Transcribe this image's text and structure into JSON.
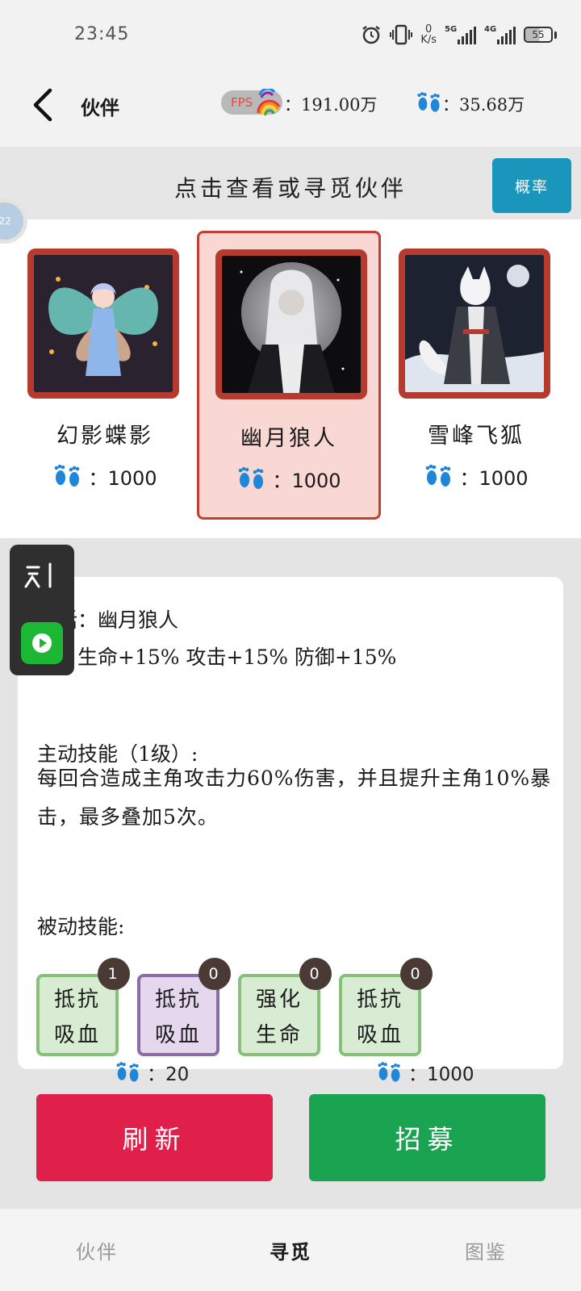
{
  "status_bar": {
    "time": "23:45",
    "net_speed_value": "0",
    "net_speed_unit": "K/s",
    "signal1_tag": "5G",
    "signal2_tag": "4G",
    "battery": "55",
    "icons": [
      "alarm-icon",
      "vibrate-icon",
      "signal-icon",
      "battery-icon"
    ]
  },
  "header": {
    "title": "伙伴",
    "fps_label": "FPS",
    "resource1_value": "：191.00万",
    "resource2_value": "：35.68万",
    "icons": [
      "back-arrow-icon",
      "rainbow-icon",
      "footprint-icon"
    ]
  },
  "banner": {
    "text": "点击查看或寻觅伙伴",
    "probability_button": "概率"
  },
  "float_ball": {
    "label": "22"
  },
  "cards": [
    {
      "name": "幻影蝶影",
      "cost": "：1000",
      "selected": false
    },
    {
      "name": "幽月狼人",
      "cost": "：1000",
      "selected": true
    },
    {
      "name": "雪峰飞狐",
      "cost": "：1000",
      "selected": false
    }
  ],
  "details": {
    "myth_line": "神话：幽月狼人",
    "attr_line": "性：生命+15% 攻击+15% 防御+15%",
    "active_title": "主动技能（1级）:",
    "active_desc": "每回合造成主角攻击力60%伤害，并且提升主角10%暴击，最多叠加5次。",
    "passive_title": "被动技能:",
    "passive_skills": [
      {
        "line1": "抵抗",
        "line2": "吸血",
        "level": "1",
        "color": "green"
      },
      {
        "line1": "抵抗",
        "line2": "吸血",
        "level": "0",
        "color": "purple"
      },
      {
        "line1": "强化",
        "line2": "生命",
        "level": "0",
        "color": "green"
      },
      {
        "line1": "抵抗",
        "line2": "吸血",
        "level": "0",
        "color": "green"
      }
    ]
  },
  "costs": {
    "refresh_cost": "：20",
    "recruit_cost": "：1000"
  },
  "actions": {
    "refresh": "刷新",
    "recruit": "招募"
  },
  "bottom_nav": {
    "items": [
      "伙伴",
      "寻觅",
      "图鉴"
    ],
    "active": "寻觅"
  },
  "colors": {
    "accent_blue": "#1a95bb",
    "refresh_red": "#e01f4b",
    "recruit_green": "#1aa452",
    "card_border": "#b73a2f",
    "selected_bg": "#f9d7d3",
    "footprint_blue": "#1f86d8"
  }
}
